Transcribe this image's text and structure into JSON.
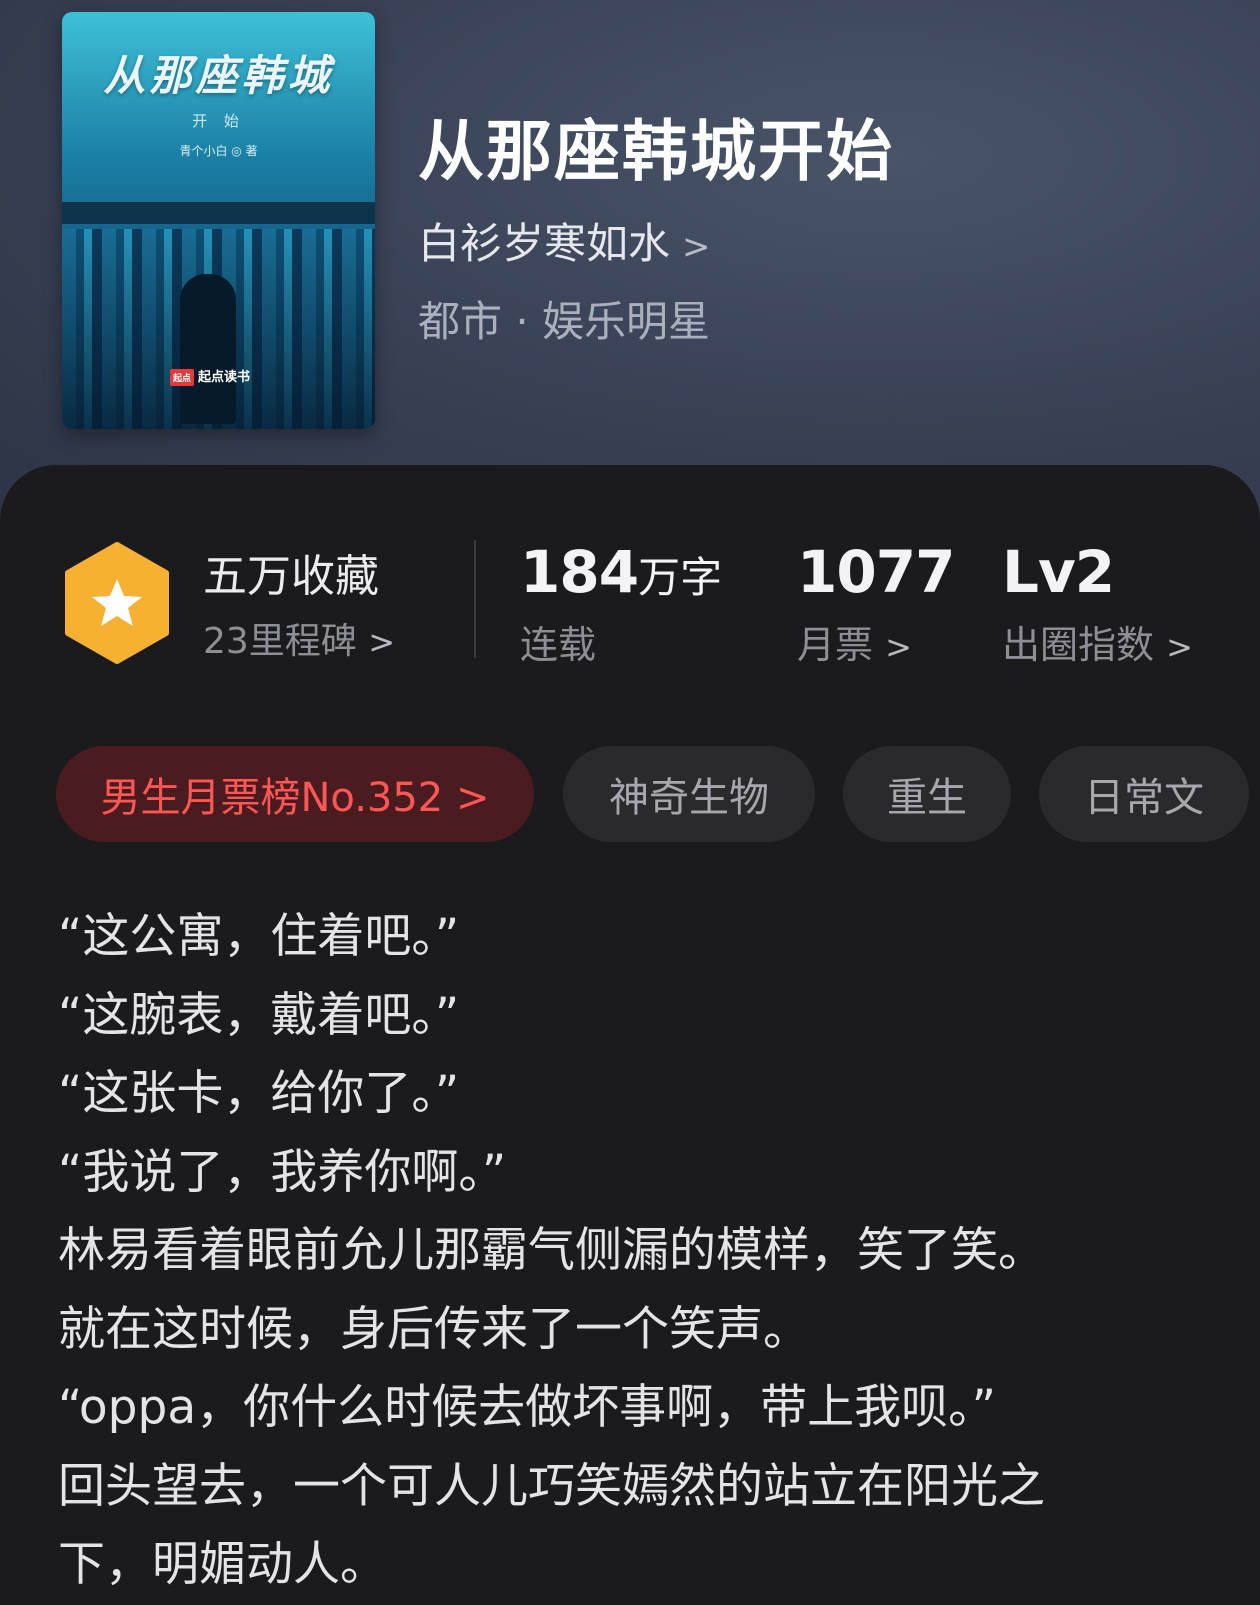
{
  "book": {
    "title": "从那座韩城开始",
    "author": "白衫岁寒如水",
    "author_chevron": ">",
    "genre": "都市 · 娱乐明星",
    "cover": {
      "title": "从那座韩城",
      "subtitle": "开 始",
      "author": "青个小白 ◎ 著",
      "publisher_mark": "起点",
      "publisher": "起点读书"
    }
  },
  "stats": {
    "collect_title": "五万收藏",
    "collect_sub": "23里程碑",
    "words_num": "184",
    "words_unit": "万字",
    "words_label": "连载",
    "tickets_num": "1077",
    "tickets_label": "月票",
    "level_num": "Lv2",
    "level_label": "出圈指数",
    "chevron": ">"
  },
  "tags": [
    {
      "label": "男生月票榜No.352 >"
    },
    {
      "label": "神奇生物"
    },
    {
      "label": "重生"
    },
    {
      "label": "日常文"
    }
  ],
  "excerpt": [
    "“这公寓，住着吧。”",
    "“这腕表，戴着吧。”",
    "“这张卡，给你了。”",
    "“我说了，我养你啊。”",
    "林易看着眼前允儿那霸气侧漏的模样，笑了笑。",
    "就在这时候，身后传来了一个笑声。",
    "“oppa，你什么时候去做坏事啊，带上我呗。”",
    "回头望去，一个可人儿巧笑嫣然的站立在阳光之",
    "下，明媚动人。"
  ],
  "colors": {
    "badge": "#f6b132",
    "rank_tag_bg": "#4a1c1f",
    "rank_tag_text": "#ff5656",
    "panel_bg": "#1b1b1d"
  }
}
